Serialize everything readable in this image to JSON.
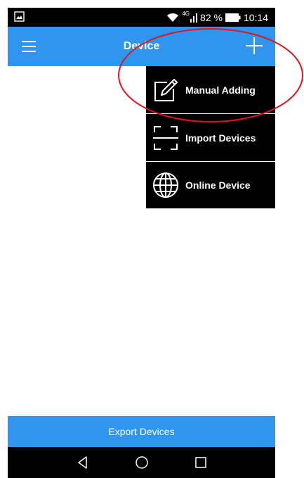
{
  "status_bar": {
    "network": "4G",
    "battery_percent": "82 %",
    "time": "10:14",
    "icons": [
      "screenshot-icon",
      "wifi-icon",
      "signal-icon",
      "battery-icon"
    ]
  },
  "app_bar": {
    "title": "Device",
    "menu_icon": "hamburger-menu-icon",
    "add_icon": "plus-icon"
  },
  "dropdown": {
    "items": [
      {
        "label": "Manual Adding",
        "icon": "edit-icon"
      },
      {
        "label": "Import Devices",
        "icon": "scan-icon"
      },
      {
        "label": "Online Device",
        "icon": "globe-icon"
      }
    ]
  },
  "footer": {
    "export_label": "Export Devices"
  },
  "nav_bar": {
    "icons": [
      "back-icon",
      "home-icon",
      "recents-icon"
    ]
  },
  "colors": {
    "primary": "#2e96ef",
    "dropdown_bg": "#000000",
    "annotation": "#e0141e"
  }
}
